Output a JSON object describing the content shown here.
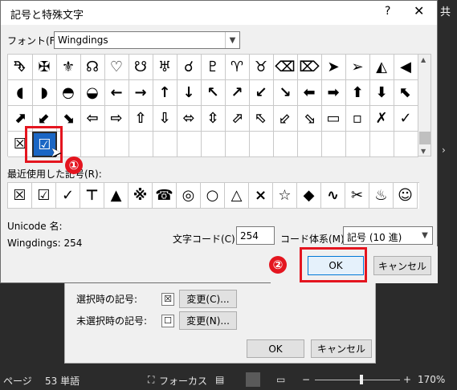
{
  "background": {
    "right_text": "共",
    "right_icon": "expand-icon"
  },
  "options_dialog": {
    "checked_label": "選択時の記号:",
    "checked_symbol": "☒",
    "unchecked_label": "未選択時の記号:",
    "unchecked_symbol": "☐",
    "change_checked": "変更(C)...",
    "change_unchecked": "変更(N)...",
    "ok": "OK",
    "cancel": "キャンセル"
  },
  "status_bar": {
    "page": "ページ",
    "words": "53 単語",
    "focus": "フォーカス",
    "zoom_minus": "−",
    "zoom_plus": "+",
    "zoom": "170%"
  },
  "symbol_dialog": {
    "title": "記号と特殊文字",
    "help": "?",
    "close": "✕",
    "font_label": "フォント(F):",
    "font_value": "Wingdings",
    "grid": [
      [
        "⮷",
        "✠",
        "⚜",
        "☊",
        "♡",
        "☋",
        "♅",
        "☌",
        "♇",
        "♈",
        "♉",
        "⌫",
        "⌦",
        "➤",
        "➢",
        "◭",
        "◀"
      ],
      [
        "◖",
        "◗",
        "◓",
        "◒",
        "←",
        "→",
        "↑",
        "↓",
        "↖",
        "↗",
        "↙",
        "↘",
        "⬅",
        "➡",
        "⬆",
        "⬇",
        "⬉"
      ],
      [
        "⬈",
        "⬋",
        "⬊",
        "⇦",
        "⇨",
        "⇧",
        "⇩",
        "⬄",
        "⇳",
        "⬀",
        "⬁",
        "⬃",
        "⬂",
        "▭",
        "▫",
        "✗",
        "✓"
      ],
      [
        "☒",
        "☑",
        "",
        "",
        "",
        "",
        "",
        "",
        "",
        "",
        "",
        "",
        "",
        "",
        "",
        "",
        ""
      ]
    ],
    "selected_symbol": "☑",
    "recent_label": "最近使用した記号(R):",
    "recent": [
      "☒",
      "☑",
      "✓",
      "⊤",
      "▲",
      "※",
      "☎",
      "◎",
      "○",
      "△",
      "×",
      "☆",
      "◆",
      "∿",
      "✂",
      "♨",
      "☺"
    ],
    "unicode_label": "Unicode 名:",
    "unicode_value": "Wingdings: 254",
    "code_label": "文字コード(C):",
    "code_value": "254",
    "system_label": "コード体系(M):",
    "system_value": "記号 (10 進)",
    "ok": "OK",
    "cancel": "キャンセル"
  },
  "annotations": {
    "step1": "①",
    "step2": "②",
    "color": "#e4151f"
  }
}
